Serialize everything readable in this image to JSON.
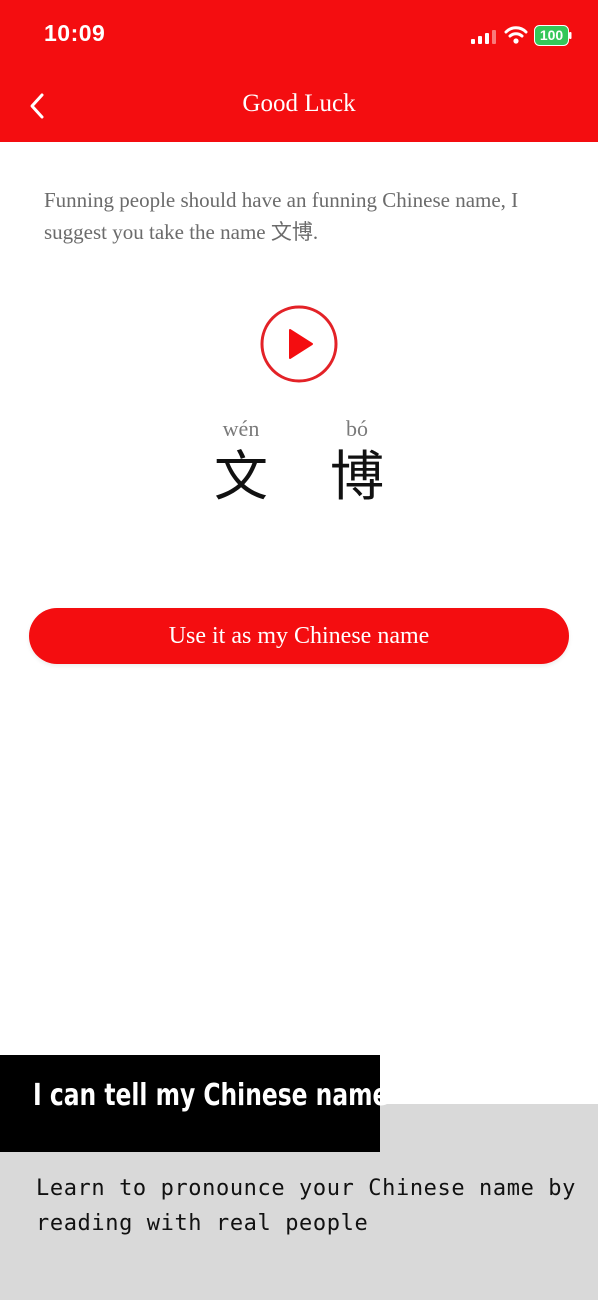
{
  "status_bar": {
    "time": "10:09",
    "battery": "100",
    "icons": [
      "signal-icon",
      "wifi-icon",
      "battery-icon"
    ]
  },
  "header": {
    "title": "Good Luck",
    "back_icon": "chevron-left-icon"
  },
  "message": "Funning people should have an funning Chinese name, I suggest you take the name 文博.",
  "audio": {
    "icon": "play-icon"
  },
  "name": [
    {
      "pinyin": "wén",
      "hanzi": "文"
    },
    {
      "pinyin": "bó",
      "hanzi": "博"
    }
  ],
  "use_button": "Use it as my Chinese name",
  "banner": {
    "title": "I can tell my Chinese name",
    "subtitle": "Learn to pronounce your Chinese name by reading with real people"
  },
  "colors": {
    "accent": "#f40d10",
    "banner_gray": "#d9d9d9",
    "battery_green": "#34c759"
  }
}
